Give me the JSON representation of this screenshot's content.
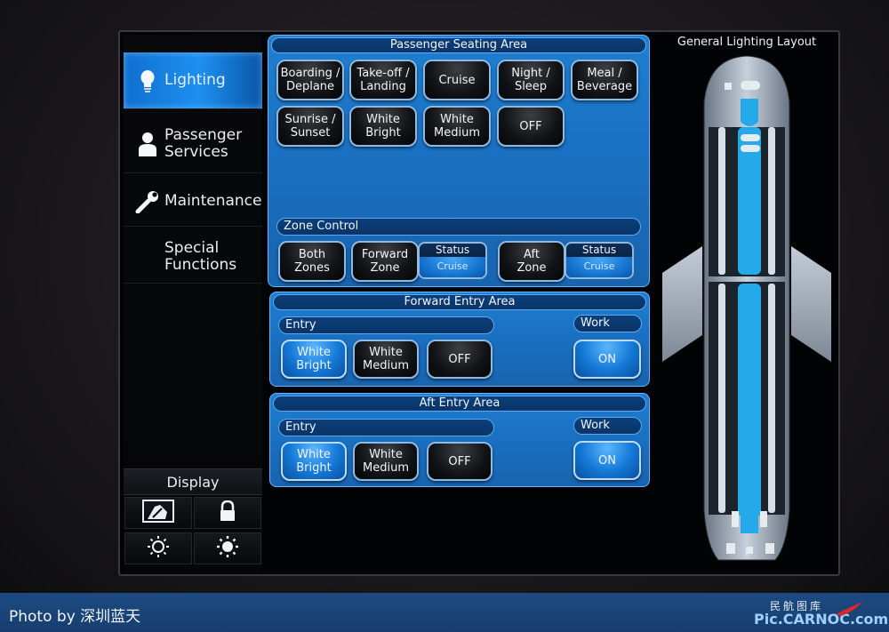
{
  "sidebar": {
    "items": [
      {
        "label": "Lighting",
        "icon": "lightbulb-icon",
        "active": true
      },
      {
        "label": "Passenger Services",
        "icon": "person-icon",
        "active": false
      },
      {
        "label": "Maintenance",
        "icon": "wrench-icon",
        "active": false
      },
      {
        "label": "Special Functions",
        "active": false
      }
    ],
    "display": {
      "label": "Display",
      "buttons": [
        "clean-screen-icon",
        "lock-icon",
        "brightness-down-icon",
        "brightness-up-icon"
      ]
    }
  },
  "seating": {
    "title": "Passenger Seating Area",
    "scenes": [
      "Boarding /\nDeplane",
      "Take-off /\nLanding",
      "Cruise",
      "Night /\nSleep",
      "Meal /\nBeverage",
      "Sunrise /\nSunset",
      "White\nBright",
      "White\nMedium",
      "OFF"
    ],
    "zone_control": {
      "title": "Zone Control",
      "both_zones": "Both\nZones",
      "forward_zone": "Forward\nZone",
      "forward_status_label": "Status",
      "forward_status_value": "Cruise",
      "aft_zone": "Aft\nZone",
      "aft_status_label": "Status",
      "aft_status_value": "Cruise"
    }
  },
  "forward_entry": {
    "title": "Forward Entry Area",
    "entry_label": "Entry",
    "entry_buttons": [
      "White\nBright",
      "White\nMedium",
      "OFF"
    ],
    "work_label": "Work",
    "work_button": "ON"
  },
  "aft_entry": {
    "title": "Aft Entry Area",
    "entry_label": "Entry",
    "entry_buttons": [
      "White\nBright",
      "White\nMedium",
      "OFF"
    ],
    "work_label": "Work",
    "work_button": "ON"
  },
  "layout": {
    "title": "General Lighting Layout"
  },
  "footer": {
    "credit": "Photo by 深圳蓝天",
    "brand_cn": "民航图库",
    "brand": "Pic.CARNOC.com"
  },
  "colors": {
    "accent": "#1e90f0",
    "panel": "#1a6fc0",
    "lit_zone": "#22a8e8"
  }
}
